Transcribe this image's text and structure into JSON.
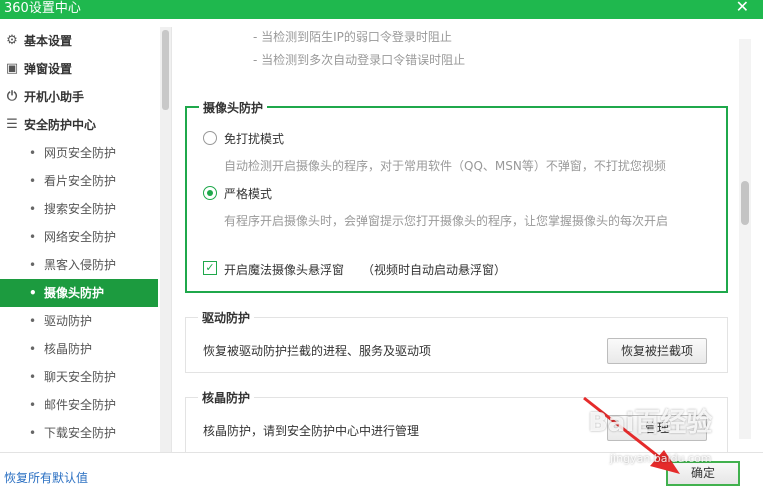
{
  "window": {
    "title": "360设置中心",
    "close_glyph": "✕"
  },
  "sidebar": {
    "top_items": [
      {
        "label": "基本设置",
        "icon": "gear-icon"
      },
      {
        "label": "弹窗设置",
        "icon": "window-icon"
      },
      {
        "label": "开机小助手",
        "icon": "power-icon"
      },
      {
        "label": "安全防护中心",
        "icon": "list-icon"
      }
    ],
    "sub_items": [
      {
        "label": "网页安全防护"
      },
      {
        "label": "看片安全防护"
      },
      {
        "label": "搜索安全防护"
      },
      {
        "label": "网络安全防护"
      },
      {
        "label": "黑客入侵防护"
      },
      {
        "label": "摄像头防护"
      },
      {
        "label": "驱动防护"
      },
      {
        "label": "核晶防护"
      },
      {
        "label": "聊天安全防护"
      },
      {
        "label": "邮件安全防护"
      },
      {
        "label": "下载安全防护"
      }
    ],
    "active_item": "摄像头防护",
    "sub_bullet": "•"
  },
  "main": {
    "hints": [
      "- 当检测到陌生IP的弱口令登录时阻止",
      "- 当检测到多次自动登录口令错误时阻止"
    ],
    "camera": {
      "legend": "摄像头防护",
      "options": [
        {
          "label": "免打扰模式",
          "desc": "自动检测开启摄像头的程序，对于常用软件（QQ、MSN等）不弹窗，不打扰您视频",
          "checked": false
        },
        {
          "label": "严格模式",
          "desc": "有程序开启摄像头时，会弹窗提示您打开摄像头的程序，让您掌握摄像头的每次开启",
          "checked": true
        }
      ],
      "checkbox": {
        "label": "开启魔法摄像头悬浮窗",
        "note": "（视频时自动启动悬浮窗）",
        "checked": true,
        "mark": "✓"
      }
    },
    "driver": {
      "legend": "驱动防护",
      "text": "恢复被驱动防护拦截的进程、服务及驱动项",
      "button": "恢复被拦截项"
    },
    "core": {
      "legend": "核晶防护",
      "text": "核晶防护，请到安全防护中心中进行管理",
      "button": "管理"
    }
  },
  "footer": {
    "restore_link": "恢复所有默认值",
    "ok_button": "确定"
  },
  "watermark": {
    "text": "Bai百经验",
    "url": "jingyan.baidu.com"
  },
  "colors": {
    "brand_green": "#1fb84e",
    "active_green": "#1c9b3f",
    "arrow_red": "#e52b2b",
    "link_blue": "#2a6fc2"
  }
}
